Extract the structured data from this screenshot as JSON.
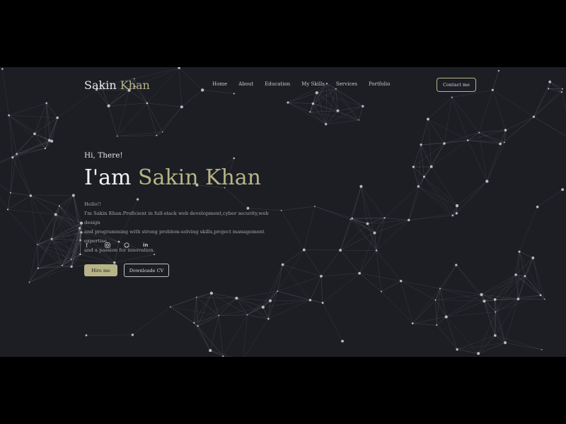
{
  "logo": {
    "first": "Sakin",
    "second": "Khan"
  },
  "nav": {
    "items": [
      "Home",
      "About",
      "Education",
      "My Skills",
      "Services",
      "Portfolio"
    ],
    "contact_label": "Contact me"
  },
  "hero": {
    "greeting": "Hi, There!",
    "headline_prefix": "I'am",
    "headline_name": "Sakin Khan",
    "bio_lines": [
      "Hello!!",
      "I'm Sakin Khan.Proficient in full-stack web development,cyber security,web design",
      "and programming with strong problem-solving skills,project management expertise",
      "and a passion for innovation."
    ],
    "social_icons": [
      "facebook-icon",
      "instagram-icon",
      "github-icon",
      "linkedin-icon"
    ],
    "hire_label": "Hire me",
    "cv_label": "Downloade CV"
  },
  "colors": {
    "accent": "#b7b487",
    "background": "#1c1e24",
    "outer": "#000000"
  }
}
